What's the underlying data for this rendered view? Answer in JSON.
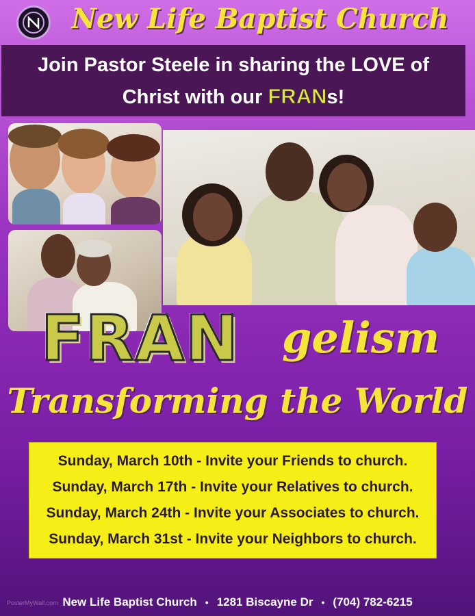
{
  "header": {
    "church_name": "New Life Baptist Church",
    "logo_icon": "n-monogram-logo-icon"
  },
  "banner": {
    "line1": "Join Pastor Steele in sharing the LOVE of",
    "line2_prefix": "Christ with our ",
    "line2_emphasis": "FRAN",
    "line2_suffix": "s!"
  },
  "title": {
    "fran": "FRAN",
    "gelism": "gelism"
  },
  "tagline": "Transforming the World",
  "schedule": [
    "Sunday, March 10th - Invite your Friends to church.",
    "Sunday, March 17th - Invite your Relatives to church.",
    "Sunday, March 24th - Invite your Associates to church.",
    "Sunday, March 31st - Invite your Neighbors to church."
  ],
  "footer": {
    "name": "New Life Baptist Church",
    "address": "1281 Biscayne Dr",
    "phone": "(704) 782-6215",
    "separator": "•"
  },
  "watermark": "PosterMyWall.com",
  "colors": {
    "accent_yellow": "#f5e43a",
    "banner_purple": "#4b1656",
    "schedule_bg": "#f6ee17"
  }
}
